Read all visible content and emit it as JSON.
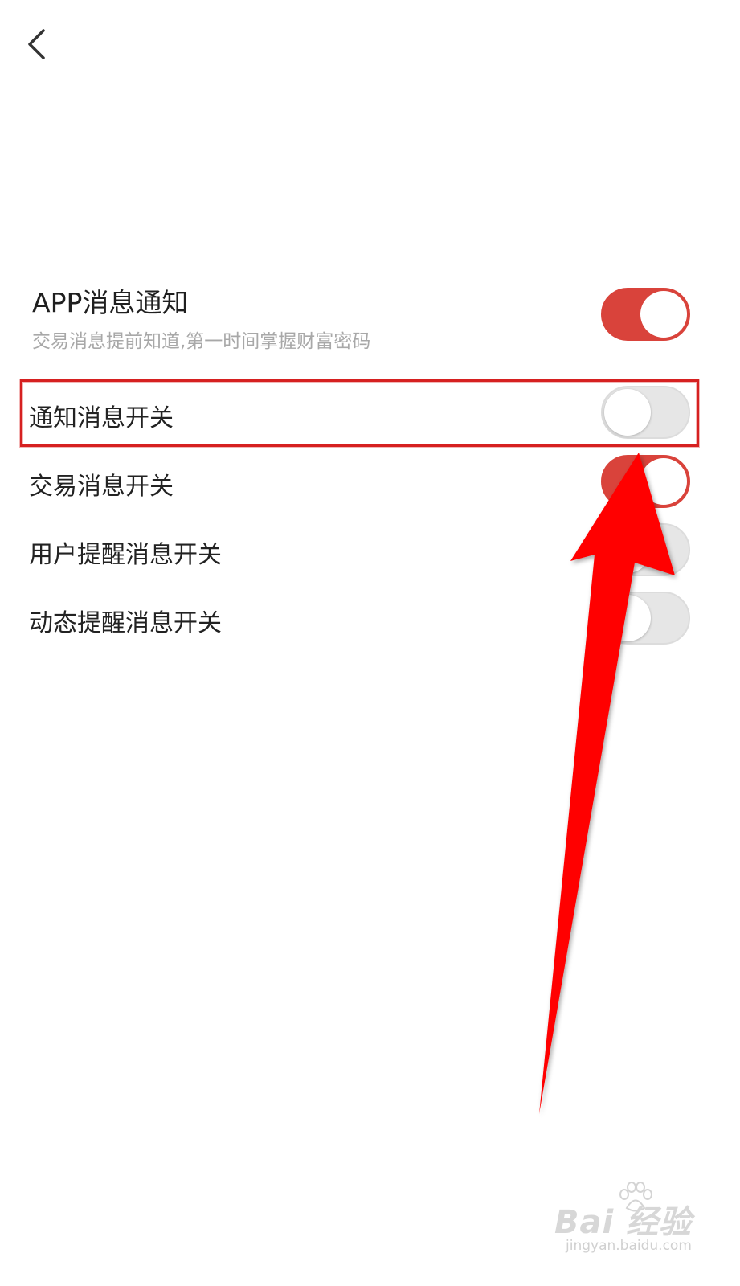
{
  "header": {
    "back_icon": "chevron-left-icon"
  },
  "app_notification": {
    "title": "APP消息通知",
    "subtitle": "交易消息提前知道,第一时间掌握财富密码",
    "toggle_on": true
  },
  "settings": [
    {
      "label": "通知消息开关",
      "toggle_on": false
    },
    {
      "label": "交易消息开关",
      "toggle_on": true
    },
    {
      "label": "用户提醒消息开关",
      "toggle_on": false
    },
    {
      "label": "动态提醒消息开关",
      "toggle_on": false
    }
  ],
  "colors": {
    "accent": "#d9433b",
    "toggle_off": "#e6e6e6",
    "annotation": "#ff0000"
  },
  "watermark": {
    "brand": "Bai  经验",
    "url": "jingyan.baidu.com"
  }
}
